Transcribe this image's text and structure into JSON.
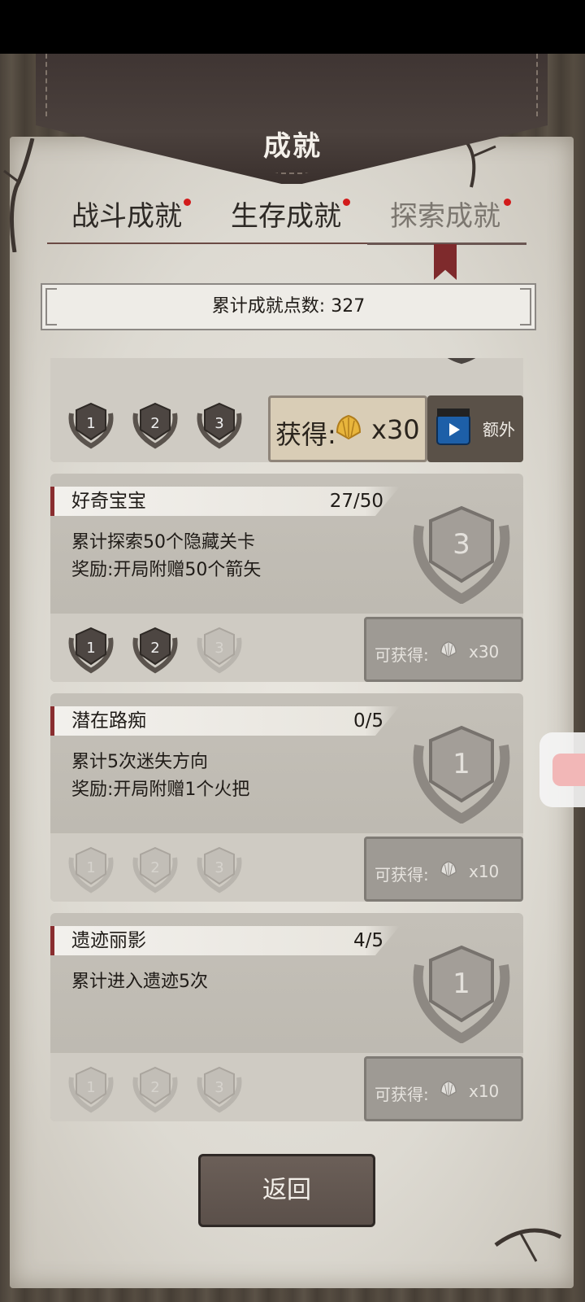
{
  "title": "成就",
  "tabs": [
    {
      "label": "战斗成就",
      "active": false,
      "has_dot": true
    },
    {
      "label": "生存成就",
      "active": false,
      "has_dot": true
    },
    {
      "label": "探索成就",
      "active": true,
      "has_dot": true
    }
  ],
  "points": {
    "label": "累计成就点数: 327"
  },
  "partial_card": {
    "tiers": [
      "1",
      "2",
      "3"
    ],
    "get_button": {
      "label": "获得:",
      "count": "x30",
      "icon": "shell-icon"
    },
    "extra_button": {
      "label": "额外",
      "icon": "video-icon"
    }
  },
  "cards": [
    {
      "name": "好奇宝宝",
      "progress": "27/50",
      "desc": [
        "累计探索50个隐藏关卡",
        "奖励:开局附赠50个箭矢"
      ],
      "badge_level": "3",
      "tiers": [
        "1",
        "2",
        "3"
      ],
      "tiers_earned": [
        true,
        true,
        false
      ],
      "reward": {
        "label": "可获得:",
        "count": "x30"
      }
    },
    {
      "name": "潜在路痴",
      "progress": "0/5",
      "desc": [
        "累计5次迷失方向",
        "奖励:开局附赠1个火把"
      ],
      "badge_level": "1",
      "tiers": [
        "1",
        "2",
        "3"
      ],
      "tiers_earned": [
        false,
        false,
        false
      ],
      "reward": {
        "label": "可获得:",
        "count": "x10"
      }
    },
    {
      "name": "遗迹丽影",
      "progress": "4/5",
      "desc": [
        "累计进入遗迹5次"
      ],
      "badge_level": "1",
      "tiers": [
        "1",
        "2",
        "3"
      ],
      "tiers_earned": [
        false,
        false,
        false
      ],
      "reward": {
        "label": "可获得:",
        "count": "x10"
      }
    }
  ],
  "return_label": "返回",
  "colors": {
    "accent_red": "#d21b1b",
    "ribbon": "#7e2a2c",
    "leather": "#453a36"
  }
}
